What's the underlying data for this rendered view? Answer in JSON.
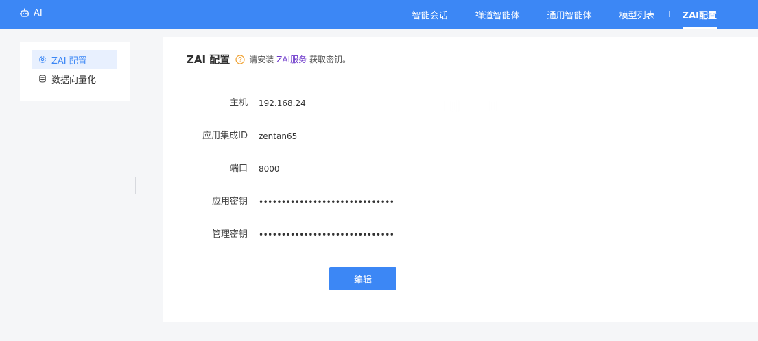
{
  "app": {
    "brand_label": "AI"
  },
  "nav": {
    "items": [
      {
        "label": "智能会话"
      },
      {
        "label": "禅道智能体"
      },
      {
        "label": "通用智能体"
      },
      {
        "label": "模型列表"
      },
      {
        "label": "ZAI配置",
        "active": true
      }
    ]
  },
  "sidebar": {
    "items": [
      {
        "label": "ZAI 配置",
        "icon": "gear-icon",
        "active": true
      },
      {
        "label": "数据向量化",
        "icon": "database-icon"
      }
    ]
  },
  "main": {
    "title": "ZAI 配置",
    "tip_prefix": "请安装",
    "tip_link": "ZAI服务",
    "tip_suffix": "获取密钥。",
    "fields": [
      {
        "label": "主机",
        "value": "192.168.24"
      },
      {
        "label": "应用集成ID",
        "value": "zentan65"
      },
      {
        "label": "端口",
        "value": "8000"
      },
      {
        "label": "应用密钥",
        "value": "••••••••••••••••••••••••••••••"
      },
      {
        "label": "管理密钥",
        "value": "••••••••••••••••••••••••••••••"
      }
    ],
    "edit_label": "编辑"
  },
  "colors": {
    "primary": "#3c87f5",
    "link": "#6a34c9",
    "help": "#f0a02e"
  }
}
